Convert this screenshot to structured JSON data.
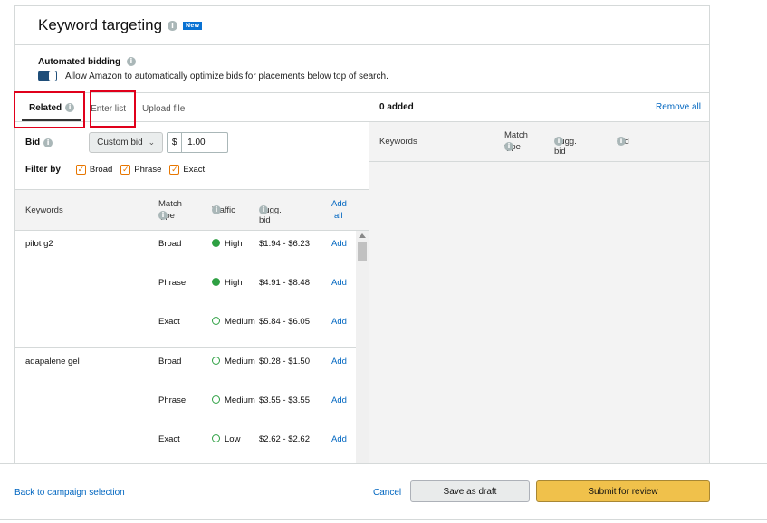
{
  "header": {
    "title": "Keyword targeting",
    "badge": "New"
  },
  "automated_bidding": {
    "title": "Automated bidding",
    "description": "Allow Amazon to automatically optimize bids for placements below top of search."
  },
  "tabs": [
    {
      "label": "Related"
    },
    {
      "label": "Enter list"
    },
    {
      "label": "Upload file"
    }
  ],
  "bid": {
    "label": "Bid",
    "select_value": "Custom bid",
    "currency": "$",
    "amount": "1.00"
  },
  "filter": {
    "label": "Filter by",
    "options": [
      {
        "label": "Broad",
        "checked": true
      },
      {
        "label": "Phrase",
        "checked": true
      },
      {
        "label": "Exact",
        "checked": true
      }
    ]
  },
  "table": {
    "columns": {
      "keywords": "Keywords",
      "match_type_1": "Match",
      "match_type_2": "type",
      "traffic": "Traffic",
      "sugg_bid": "Sugg. bid",
      "add_all_1": "Add",
      "add_all_2": "all"
    },
    "groups": [
      {
        "keyword": "pilot g2",
        "rows": [
          {
            "match": "Broad",
            "traffic": "High",
            "level": "high",
            "sugg": "$1.94 - $6.23",
            "action": "Add"
          },
          {
            "match": "Phrase",
            "traffic": "High",
            "level": "high",
            "sugg": "$4.91 - $8.48",
            "action": "Add"
          },
          {
            "match": "Exact",
            "traffic": "Medium",
            "level": "medium",
            "sugg": "$5.84 - $6.05",
            "action": "Add"
          }
        ]
      },
      {
        "keyword": "adapalene gel",
        "rows": [
          {
            "match": "Broad",
            "traffic": "Medium",
            "level": "medium",
            "sugg": "$0.28 - $1.50",
            "action": "Add"
          },
          {
            "match": "Phrase",
            "traffic": "Medium",
            "level": "medium",
            "sugg": "$3.55 - $3.55",
            "action": "Add"
          },
          {
            "match": "Exact",
            "traffic": "Low",
            "level": "low",
            "sugg": "$2.62 - $2.62",
            "action": "Add"
          }
        ]
      }
    ]
  },
  "right_panel": {
    "count": "0 added",
    "remove_all": "Remove all",
    "columns": {
      "keywords": "Keywords",
      "match_1": "Match",
      "match_2": "type",
      "sugg_bid": "Sugg. bid",
      "bid": "Bid"
    }
  },
  "footer": {
    "back": "Back to campaign selection",
    "cancel": "Cancel",
    "draft": "Save as draft",
    "submit": "Submit for review"
  },
  "colors": {
    "link": "#0066c0",
    "submit": "#f0c14b",
    "traffic_dot": "#2ea043",
    "highlight": "#e0001b",
    "toggle": "#1f4e79"
  }
}
